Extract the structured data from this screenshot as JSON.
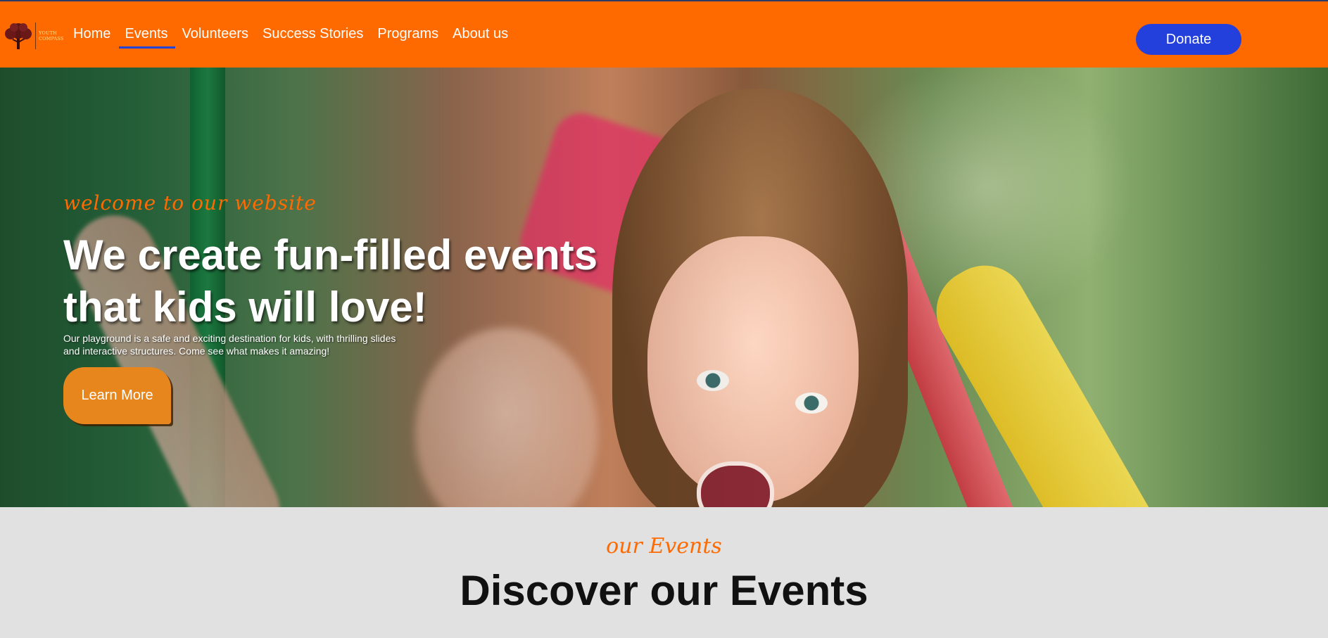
{
  "colors": {
    "nav_bg": "#ff6a00",
    "accent_orange": "#ff6a00",
    "donate_bg": "#2340dc",
    "active_underline": "#2344d4",
    "learn_more_bg": "#e8861e",
    "section_bg": "#e1e1e1"
  },
  "header": {
    "logo": {
      "icon": "tree-logo-icon",
      "text_line1": "YOUTH",
      "text_line2": "COMPASS"
    },
    "nav": [
      {
        "label": "Home",
        "active": false
      },
      {
        "label": "Events",
        "active": true
      },
      {
        "label": "Volunteers",
        "active": false
      },
      {
        "label": "Success Stories",
        "active": false
      },
      {
        "label": "Programs",
        "active": false
      },
      {
        "label": "About us",
        "active": false
      }
    ],
    "donate_label": "Donate"
  },
  "hero": {
    "subtitle": "welcome to our website",
    "title_line1": "We create fun-filled events",
    "title_line2": "that kids will love!",
    "description": "Our playground is a safe and exciting destination for kids, with thrilling slides and interactive structures. Come see what makes it amazing!",
    "cta_label": "Learn More"
  },
  "events_section": {
    "subtitle": "our Events",
    "title": "Discover our Events"
  }
}
